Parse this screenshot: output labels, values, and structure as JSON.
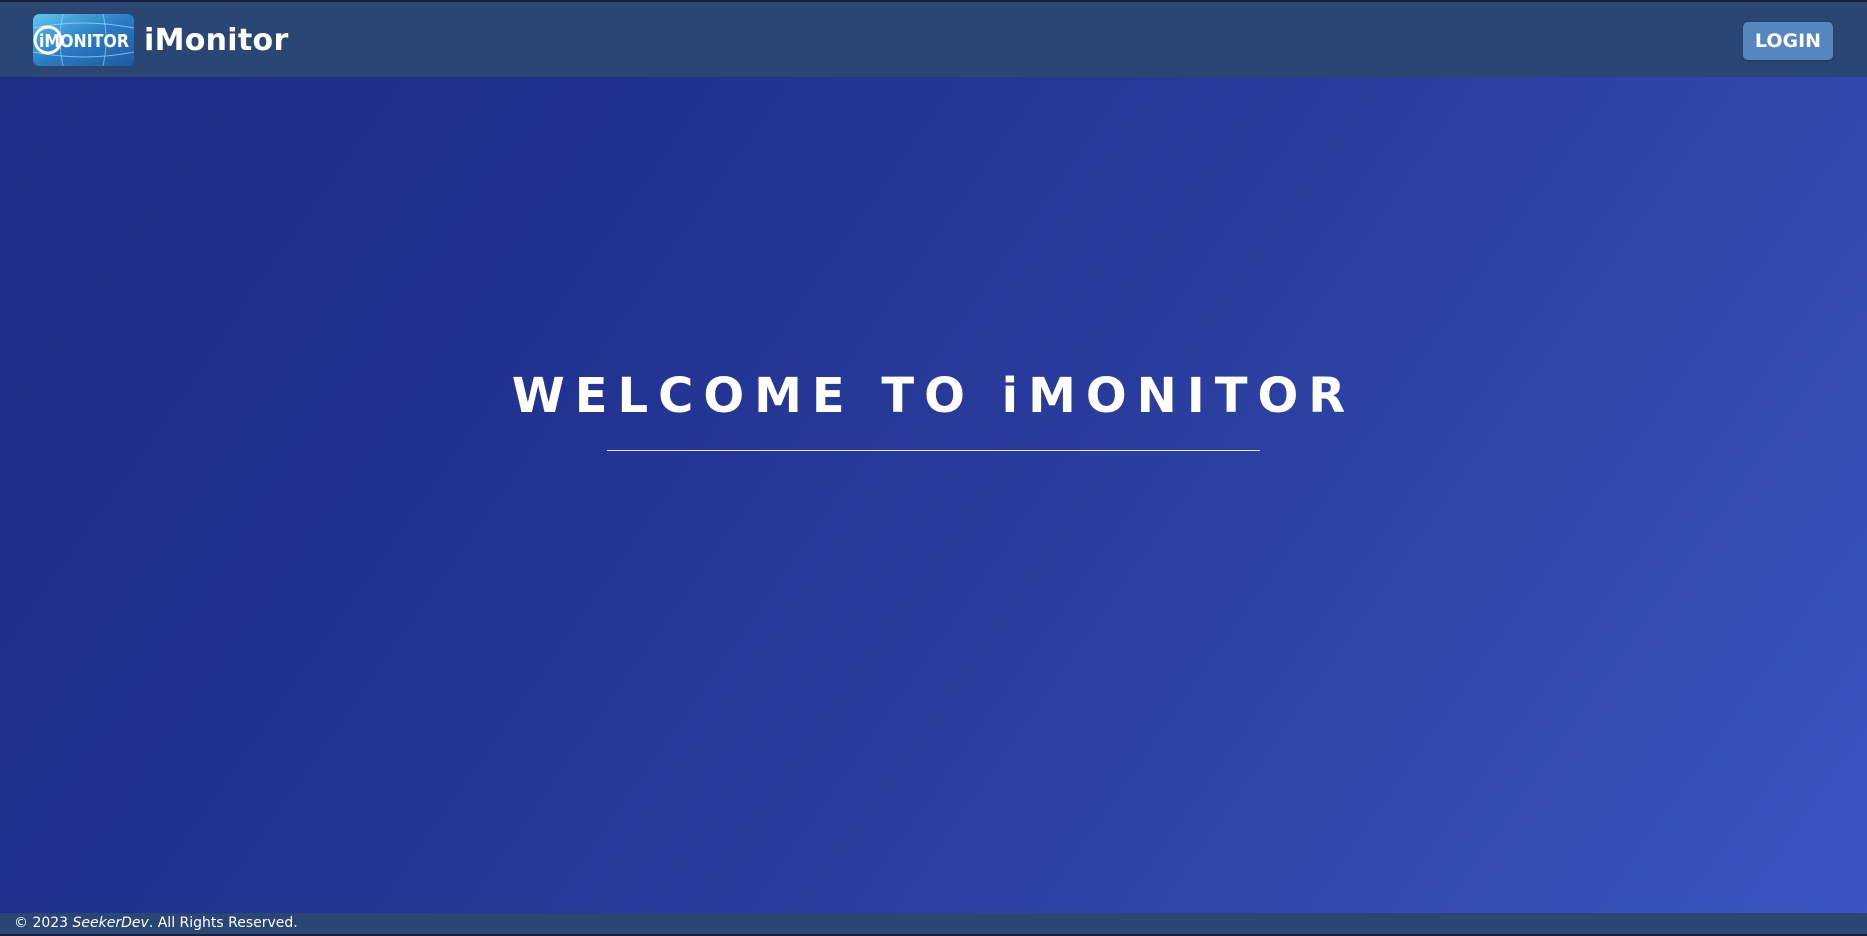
{
  "header": {
    "logo_text": "iMONITOR",
    "brand_name": "iMonitor",
    "login_label": "LOGIN"
  },
  "hero": {
    "title": "WELCOME TO iMONITOR"
  },
  "footer": {
    "copyright_prefix": "© 2023",
    "company": "SeekerDev",
    "rights": ". All Rights Reserved."
  },
  "colors": {
    "header_bg": "#2a4673",
    "login_bg": "#5685bf",
    "gradient_start": "#1f2d84",
    "gradient_end": "#3a56c2",
    "text": "#ffffff"
  },
  "icons": {
    "logo": "imonitor-logo-icon"
  }
}
